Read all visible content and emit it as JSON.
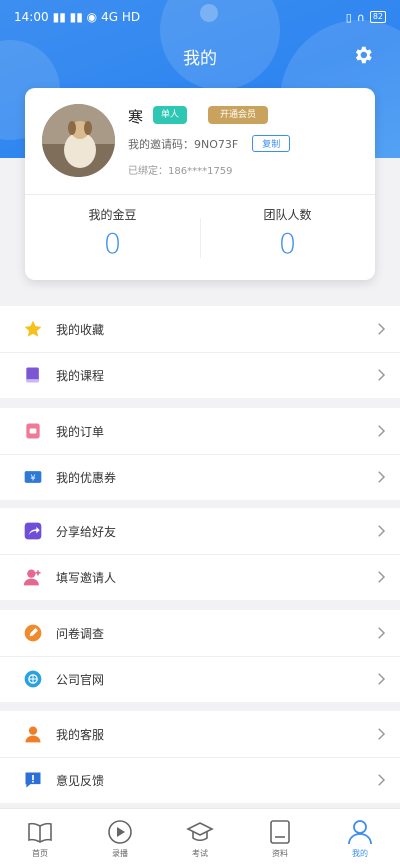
{
  "status_bar": {
    "time": "14:00",
    "signals": "⁵⁶ᵢₗ ⁵⁶ᵢₗ",
    "network": "4G HD",
    "battery": "82"
  },
  "header": {
    "title": "我的"
  },
  "profile": {
    "name": "寒",
    "badge_person": "单人",
    "badge_vip": "开通会员",
    "invite_label": "我的邀请码：",
    "invite_code": "9NO73F",
    "copy_label": "复制",
    "bound_label": "已绑定：",
    "bound_phone": "186****1759",
    "stats": [
      {
        "label": "我的金豆",
        "value": "0"
      },
      {
        "label": "团队人数",
        "value": "0"
      }
    ]
  },
  "menu_groups": [
    [
      {
        "label": "我的收藏",
        "icon": "star-icon"
      },
      {
        "label": "我的课程",
        "icon": "book-icon"
      }
    ],
    [
      {
        "label": "我的订单",
        "icon": "order-icon"
      },
      {
        "label": "我的优惠券",
        "icon": "coupon-icon"
      }
    ],
    [
      {
        "label": "分享给好友",
        "icon": "share-icon"
      },
      {
        "label": "填写邀请人",
        "icon": "person-add-icon"
      }
    ],
    [
      {
        "label": "问卷调查",
        "icon": "survey-icon"
      },
      {
        "label": "公司官网",
        "icon": "globe-icon"
      }
    ],
    [
      {
        "label": "我的客服",
        "icon": "support-icon"
      },
      {
        "label": "意见反馈",
        "icon": "feedback-icon"
      }
    ]
  ],
  "tabbar": [
    {
      "label": "首页",
      "icon": "home-book-icon"
    },
    {
      "label": "录播",
      "icon": "play-icon"
    },
    {
      "label": "考试",
      "icon": "graduation-cap-icon"
    },
    {
      "label": "资料",
      "icon": "document-icon"
    },
    {
      "label": "我的",
      "icon": "user-icon",
      "active": true
    }
  ],
  "colors": {
    "primary": "#3d8ef0",
    "badge_person": "#2ec7b3",
    "badge_vip": "#c9a35d"
  }
}
